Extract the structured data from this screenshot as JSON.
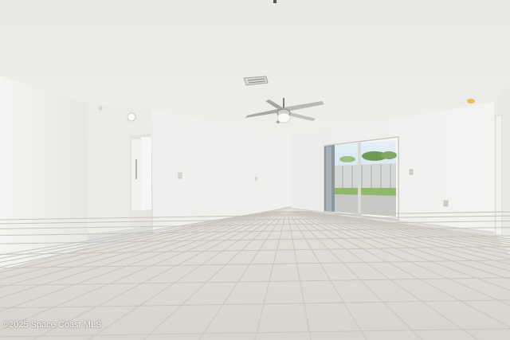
{
  "photo": {
    "watermark": "©2025 Space Coast MLS",
    "colors": {
      "ceiling": "#ebeae6",
      "wall_light": "#f3f3f1",
      "wall_shade": "#e4e4e1",
      "floor_tile": "#dcdad4",
      "grout": "#c9c6bf",
      "window_sky": "#c8dce8",
      "grass": "#8fb86a"
    },
    "objects": [
      "ceiling-fan",
      "ceiling-vent",
      "sliding-glass-door",
      "hallway-doorway",
      "wall-light-switch",
      "electrical-outlet"
    ]
  }
}
